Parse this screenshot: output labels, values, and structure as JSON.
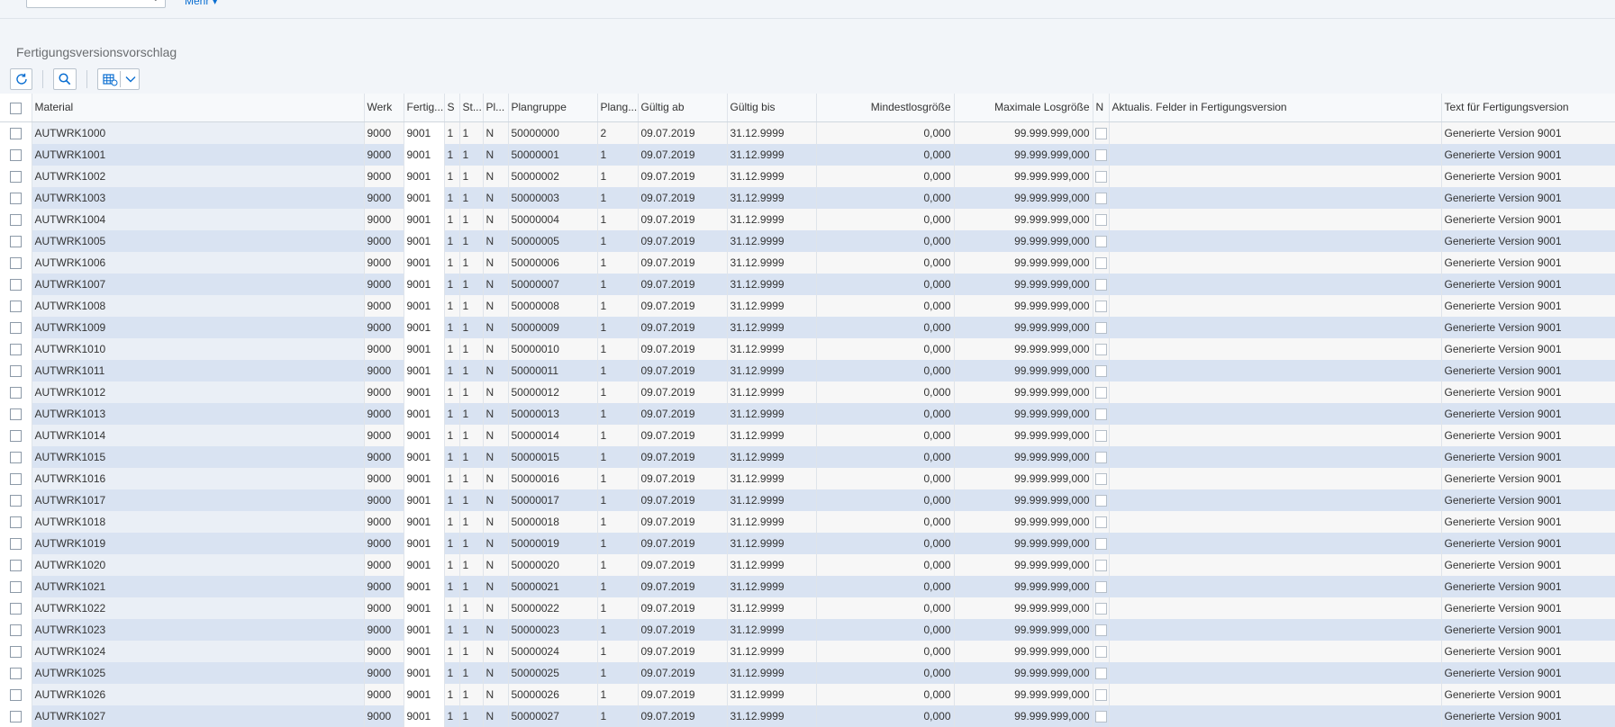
{
  "top": {
    "more_label": "Mehr ▾"
  },
  "section_title": "Fertigungsversionsvorschlag",
  "toolbar": {
    "refresh_icon": "refresh-icon",
    "search_icon": "search-icon",
    "layout_icon": "layout-grid-icon",
    "dropdown_icon": "chevron-down-icon"
  },
  "table": {
    "headers": {
      "material": "Material",
      "werk": "Werk",
      "fertig": "Fertig...",
      "s": "S",
      "st": "St...",
      "pl": "Pl...",
      "plangruppe": "Plangruppe",
      "plang": "Plang...",
      "gueltig_ab": "Gültig ab",
      "gueltig_bis": "Gültig bis",
      "mindest": "Mindestlosgröße",
      "maximal": "Maximale Losgröße",
      "n": "N",
      "aktualis": "Aktualis. Felder in Fertigungsversion",
      "text": "Text für Fertigungsversion"
    },
    "rows": [
      {
        "material": "AUTWRK1000",
        "werk": "9000",
        "fertig": "9001",
        "s": "1",
        "st": "1",
        "pl": "N",
        "plangruppe": "50000000",
        "plang": "2",
        "ab": "09.07.2019",
        "bis": "31.12.9999",
        "min": "0,000",
        "max": "99.999.999,000",
        "text": "Generierte Version 9001"
      },
      {
        "material": "AUTWRK1001",
        "werk": "9000",
        "fertig": "9001",
        "s": "1",
        "st": "1",
        "pl": "N",
        "plangruppe": "50000001",
        "plang": "1",
        "ab": "09.07.2019",
        "bis": "31.12.9999",
        "min": "0,000",
        "max": "99.999.999,000",
        "text": "Generierte Version 9001"
      },
      {
        "material": "AUTWRK1002",
        "werk": "9000",
        "fertig": "9001",
        "s": "1",
        "st": "1",
        "pl": "N",
        "plangruppe": "50000002",
        "plang": "1",
        "ab": "09.07.2019",
        "bis": "31.12.9999",
        "min": "0,000",
        "max": "99.999.999,000",
        "text": "Generierte Version 9001"
      },
      {
        "material": "AUTWRK1003",
        "werk": "9000",
        "fertig": "9001",
        "s": "1",
        "st": "1",
        "pl": "N",
        "plangruppe": "50000003",
        "plang": "1",
        "ab": "09.07.2019",
        "bis": "31.12.9999",
        "min": "0,000",
        "max": "99.999.999,000",
        "text": "Generierte Version 9001"
      },
      {
        "material": "AUTWRK1004",
        "werk": "9000",
        "fertig": "9001",
        "s": "1",
        "st": "1",
        "pl": "N",
        "plangruppe": "50000004",
        "plang": "1",
        "ab": "09.07.2019",
        "bis": "31.12.9999",
        "min": "0,000",
        "max": "99.999.999,000",
        "text": "Generierte Version 9001"
      },
      {
        "material": "AUTWRK1005",
        "werk": "9000",
        "fertig": "9001",
        "s": "1",
        "st": "1",
        "pl": "N",
        "plangruppe": "50000005",
        "plang": "1",
        "ab": "09.07.2019",
        "bis": "31.12.9999",
        "min": "0,000",
        "max": "99.999.999,000",
        "text": "Generierte Version 9001"
      },
      {
        "material": "AUTWRK1006",
        "werk": "9000",
        "fertig": "9001",
        "s": "1",
        "st": "1",
        "pl": "N",
        "plangruppe": "50000006",
        "plang": "1",
        "ab": "09.07.2019",
        "bis": "31.12.9999",
        "min": "0,000",
        "max": "99.999.999,000",
        "text": "Generierte Version 9001"
      },
      {
        "material": "AUTWRK1007",
        "werk": "9000",
        "fertig": "9001",
        "s": "1",
        "st": "1",
        "pl": "N",
        "plangruppe": "50000007",
        "plang": "1",
        "ab": "09.07.2019",
        "bis": "31.12.9999",
        "min": "0,000",
        "max": "99.999.999,000",
        "text": "Generierte Version 9001"
      },
      {
        "material": "AUTWRK1008",
        "werk": "9000",
        "fertig": "9001",
        "s": "1",
        "st": "1",
        "pl": "N",
        "plangruppe": "50000008",
        "plang": "1",
        "ab": "09.07.2019",
        "bis": "31.12.9999",
        "min": "0,000",
        "max": "99.999.999,000",
        "text": "Generierte Version 9001"
      },
      {
        "material": "AUTWRK1009",
        "werk": "9000",
        "fertig": "9001",
        "s": "1",
        "st": "1",
        "pl": "N",
        "plangruppe": "50000009",
        "plang": "1",
        "ab": "09.07.2019",
        "bis": "31.12.9999",
        "min": "0,000",
        "max": "99.999.999,000",
        "text": "Generierte Version 9001"
      },
      {
        "material": "AUTWRK1010",
        "werk": "9000",
        "fertig": "9001",
        "s": "1",
        "st": "1",
        "pl": "N",
        "plangruppe": "50000010",
        "plang": "1",
        "ab": "09.07.2019",
        "bis": "31.12.9999",
        "min": "0,000",
        "max": "99.999.999,000",
        "text": "Generierte Version 9001"
      },
      {
        "material": "AUTWRK1011",
        "werk": "9000",
        "fertig": "9001",
        "s": "1",
        "st": "1",
        "pl": "N",
        "plangruppe": "50000011",
        "plang": "1",
        "ab": "09.07.2019",
        "bis": "31.12.9999",
        "min": "0,000",
        "max": "99.999.999,000",
        "text": "Generierte Version 9001"
      },
      {
        "material": "AUTWRK1012",
        "werk": "9000",
        "fertig": "9001",
        "s": "1",
        "st": "1",
        "pl": "N",
        "plangruppe": "50000012",
        "plang": "1",
        "ab": "09.07.2019",
        "bis": "31.12.9999",
        "min": "0,000",
        "max": "99.999.999,000",
        "text": "Generierte Version 9001"
      },
      {
        "material": "AUTWRK1013",
        "werk": "9000",
        "fertig": "9001",
        "s": "1",
        "st": "1",
        "pl": "N",
        "plangruppe": "50000013",
        "plang": "1",
        "ab": "09.07.2019",
        "bis": "31.12.9999",
        "min": "0,000",
        "max": "99.999.999,000",
        "text": "Generierte Version 9001"
      },
      {
        "material": "AUTWRK1014",
        "werk": "9000",
        "fertig": "9001",
        "s": "1",
        "st": "1",
        "pl": "N",
        "plangruppe": "50000014",
        "plang": "1",
        "ab": "09.07.2019",
        "bis": "31.12.9999",
        "min": "0,000",
        "max": "99.999.999,000",
        "text": "Generierte Version 9001"
      },
      {
        "material": "AUTWRK1015",
        "werk": "9000",
        "fertig": "9001",
        "s": "1",
        "st": "1",
        "pl": "N",
        "plangruppe": "50000015",
        "plang": "1",
        "ab": "09.07.2019",
        "bis": "31.12.9999",
        "min": "0,000",
        "max": "99.999.999,000",
        "text": "Generierte Version 9001"
      },
      {
        "material": "AUTWRK1016",
        "werk": "9000",
        "fertig": "9001",
        "s": "1",
        "st": "1",
        "pl": "N",
        "plangruppe": "50000016",
        "plang": "1",
        "ab": "09.07.2019",
        "bis": "31.12.9999",
        "min": "0,000",
        "max": "99.999.999,000",
        "text": "Generierte Version 9001"
      },
      {
        "material": "AUTWRK1017",
        "werk": "9000",
        "fertig": "9001",
        "s": "1",
        "st": "1",
        "pl": "N",
        "plangruppe": "50000017",
        "plang": "1",
        "ab": "09.07.2019",
        "bis": "31.12.9999",
        "min": "0,000",
        "max": "99.999.999,000",
        "text": "Generierte Version 9001"
      },
      {
        "material": "AUTWRK1018",
        "werk": "9000",
        "fertig": "9001",
        "s": "1",
        "st": "1",
        "pl": "N",
        "plangruppe": "50000018",
        "plang": "1",
        "ab": "09.07.2019",
        "bis": "31.12.9999",
        "min": "0,000",
        "max": "99.999.999,000",
        "text": "Generierte Version 9001"
      },
      {
        "material": "AUTWRK1019",
        "werk": "9000",
        "fertig": "9001",
        "s": "1",
        "st": "1",
        "pl": "N",
        "plangruppe": "50000019",
        "plang": "1",
        "ab": "09.07.2019",
        "bis": "31.12.9999",
        "min": "0,000",
        "max": "99.999.999,000",
        "text": "Generierte Version 9001"
      },
      {
        "material": "AUTWRK1020",
        "werk": "9000",
        "fertig": "9001",
        "s": "1",
        "st": "1",
        "pl": "N",
        "plangruppe": "50000020",
        "plang": "1",
        "ab": "09.07.2019",
        "bis": "31.12.9999",
        "min": "0,000",
        "max": "99.999.999,000",
        "text": "Generierte Version 9001"
      },
      {
        "material": "AUTWRK1021",
        "werk": "9000",
        "fertig": "9001",
        "s": "1",
        "st": "1",
        "pl": "N",
        "plangruppe": "50000021",
        "plang": "1",
        "ab": "09.07.2019",
        "bis": "31.12.9999",
        "min": "0,000",
        "max": "99.999.999,000",
        "text": "Generierte Version 9001"
      },
      {
        "material": "AUTWRK1022",
        "werk": "9000",
        "fertig": "9001",
        "s": "1",
        "st": "1",
        "pl": "N",
        "plangruppe": "50000022",
        "plang": "1",
        "ab": "09.07.2019",
        "bis": "31.12.9999",
        "min": "0,000",
        "max": "99.999.999,000",
        "text": "Generierte Version 9001"
      },
      {
        "material": "AUTWRK1023",
        "werk": "9000",
        "fertig": "9001",
        "s": "1",
        "st": "1",
        "pl": "N",
        "plangruppe": "50000023",
        "plang": "1",
        "ab": "09.07.2019",
        "bis": "31.12.9999",
        "min": "0,000",
        "max": "99.999.999,000",
        "text": "Generierte Version 9001"
      },
      {
        "material": "AUTWRK1024",
        "werk": "9000",
        "fertig": "9001",
        "s": "1",
        "st": "1",
        "pl": "N",
        "plangruppe": "50000024",
        "plang": "1",
        "ab": "09.07.2019",
        "bis": "31.12.9999",
        "min": "0,000",
        "max": "99.999.999,000",
        "text": "Generierte Version 9001"
      },
      {
        "material": "AUTWRK1025",
        "werk": "9000",
        "fertig": "9001",
        "s": "1",
        "st": "1",
        "pl": "N",
        "plangruppe": "50000025",
        "plang": "1",
        "ab": "09.07.2019",
        "bis": "31.12.9999",
        "min": "0,000",
        "max": "99.999.999,000",
        "text": "Generierte Version 9001"
      },
      {
        "material": "AUTWRK1026",
        "werk": "9000",
        "fertig": "9001",
        "s": "1",
        "st": "1",
        "pl": "N",
        "plangruppe": "50000026",
        "plang": "1",
        "ab": "09.07.2019",
        "bis": "31.12.9999",
        "min": "0,000",
        "max": "99.999.999,000",
        "text": "Generierte Version 9001"
      },
      {
        "material": "AUTWRK1027",
        "werk": "9000",
        "fertig": "9001",
        "s": "1",
        "st": "1",
        "pl": "N",
        "plangruppe": "50000027",
        "plang": "1",
        "ab": "09.07.2019",
        "bis": "31.12.9999",
        "min": "0,000",
        "max": "99.999.999,000",
        "text": "Generierte Version 9001"
      }
    ]
  }
}
